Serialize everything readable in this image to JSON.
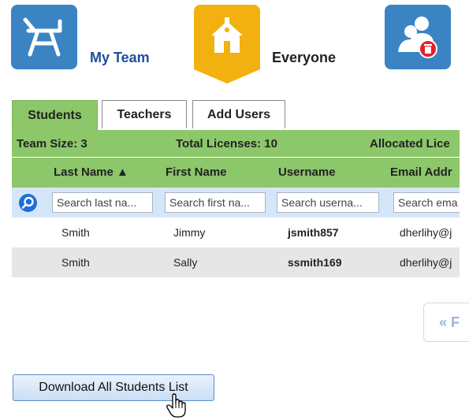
{
  "nav": {
    "my_team_label": "My Team",
    "everyone_label": "Everyone",
    "my_team_icon": "desk-icon",
    "everyone_icon": "schoolhouse-icon",
    "remove_user_icon": "remove-user-icon"
  },
  "tabs": [
    {
      "label": "Students",
      "active": true
    },
    {
      "label": "Teachers",
      "active": false
    },
    {
      "label": "Add Users",
      "active": false
    }
  ],
  "summary": {
    "team_size": "Team Size: 3",
    "total_licenses": "Total Licenses: 10",
    "allocated": "Allocated Lice"
  },
  "columns": {
    "last_name": "Last Name ▲",
    "first_name": "First Name",
    "username": "Username",
    "email": "Email Addr"
  },
  "filters": {
    "last_name": "Search last na...",
    "first_name": "Search first na...",
    "username": "Search userna...",
    "email": "Search ema"
  },
  "rows": [
    {
      "last": "Smith",
      "first": "Jimmy",
      "username": "jsmith857",
      "email": "dherlihy@j"
    },
    {
      "last": "Smith",
      "first": "Sally",
      "username": "ssmith169",
      "email": "dherlihy@j"
    }
  ],
  "pager": {
    "first_label": "« F"
  },
  "download_button": "Download All Students List",
  "colors": {
    "tile_blue": "#3a84c4",
    "tile_yellow": "#f2b10e",
    "grid_green": "#8cc76a",
    "filter_blue": "#d5e6f8",
    "remove_red": "#e0242b"
  }
}
